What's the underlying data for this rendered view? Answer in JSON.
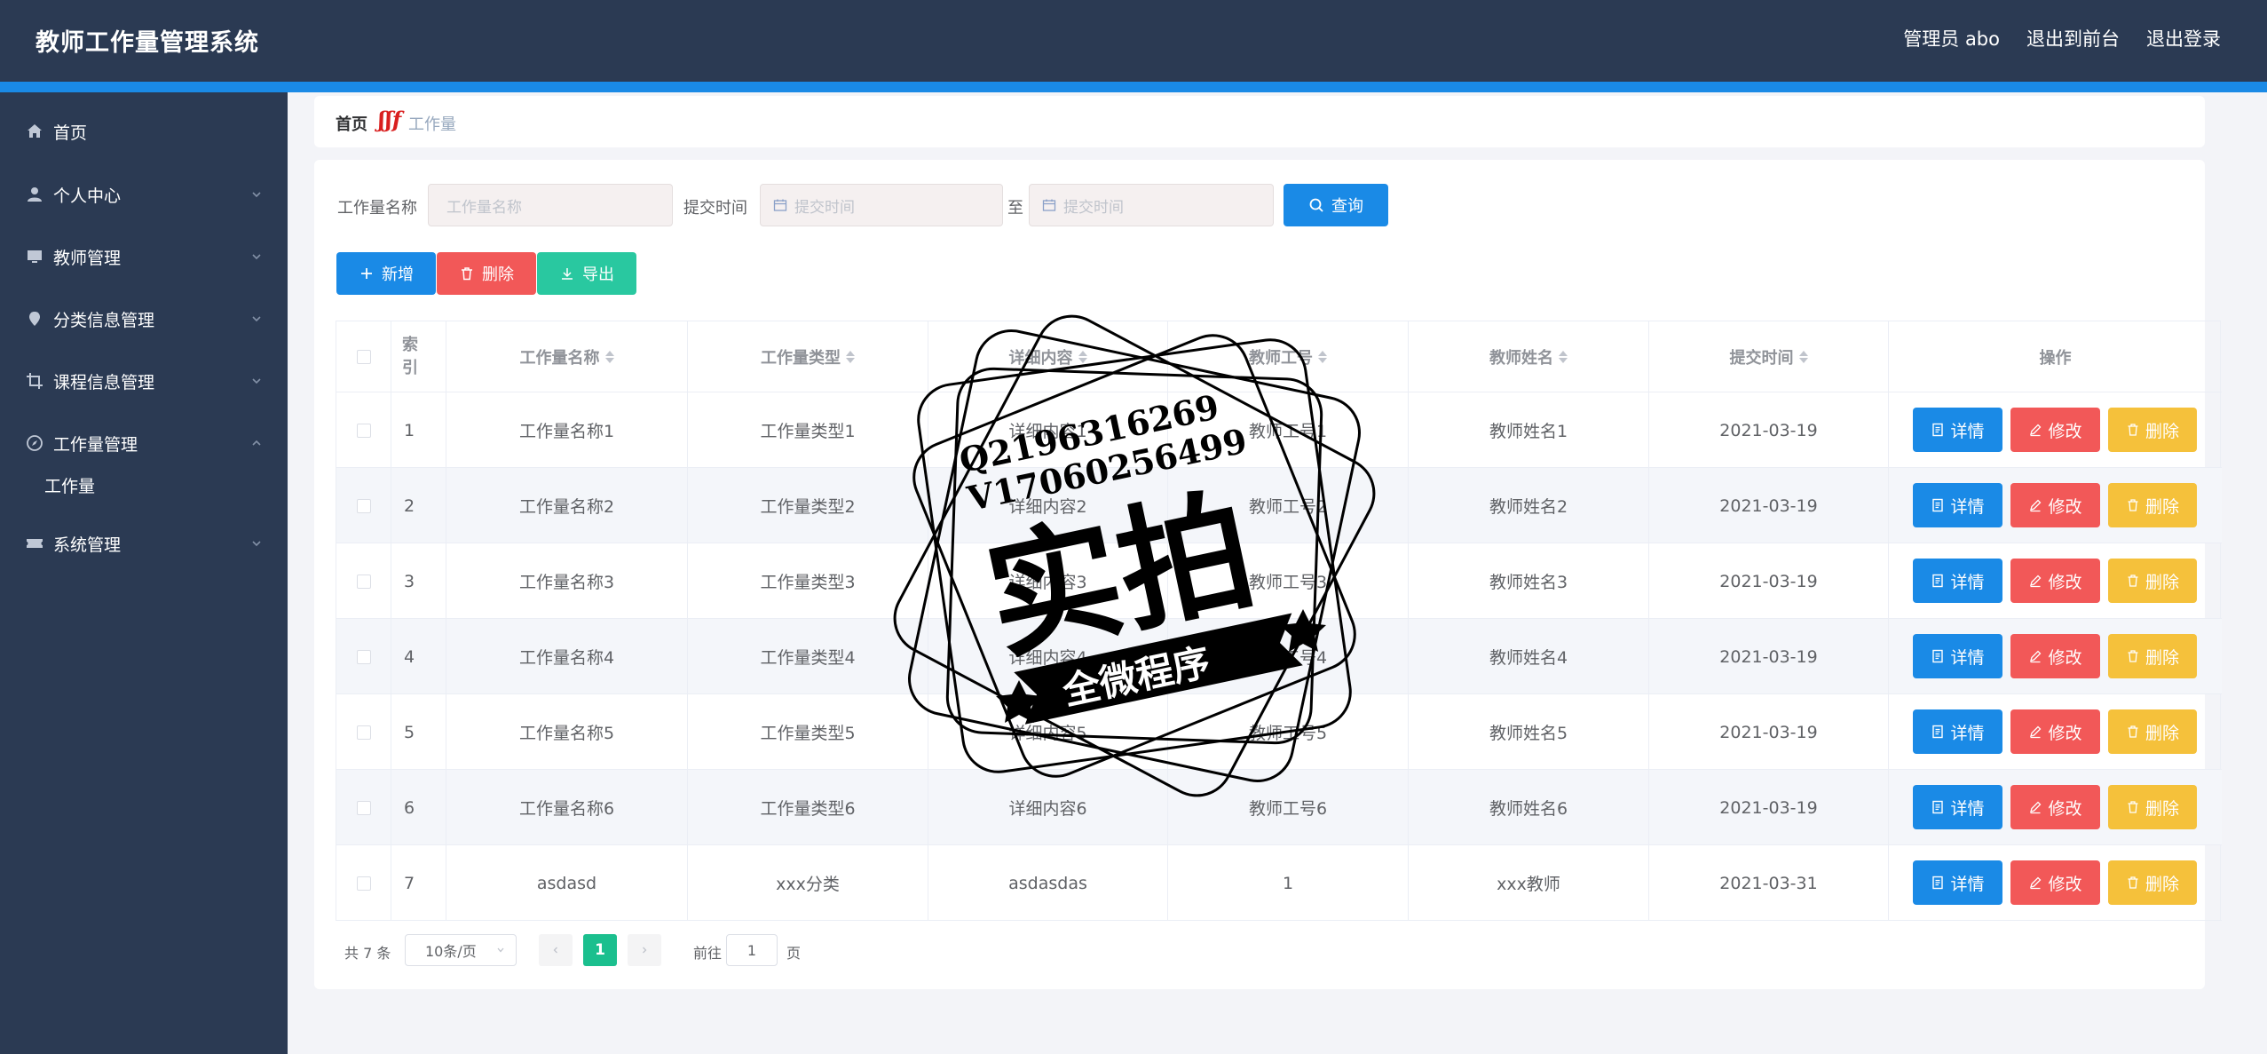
{
  "app": {
    "title": "教师工作量管理系统"
  },
  "header": {
    "user": "管理员 abo",
    "front": "退出到前台",
    "logout": "退出登录"
  },
  "sidebar": {
    "items": [
      {
        "label": "首页",
        "icon": "home-icon"
      },
      {
        "label": "个人中心",
        "icon": "user-icon"
      },
      {
        "label": "教师管理",
        "icon": "monitor-icon"
      },
      {
        "label": "分类信息管理",
        "icon": "location-icon"
      },
      {
        "label": "课程信息管理",
        "icon": "crop-icon"
      },
      {
        "label": "工作量管理",
        "icon": "compass-icon"
      },
      {
        "label": "系统管理",
        "icon": "ticket-icon"
      }
    ],
    "sub_item": "工作量"
  },
  "breadcrumb": {
    "home": "首页",
    "current": "工作量"
  },
  "filters": {
    "name_label": "工作量名称",
    "name_placeholder": "工作量名称",
    "time_label": "提交时间",
    "start_placeholder": "提交时间",
    "to": "至",
    "end_placeholder": "提交时间",
    "search": "查询"
  },
  "actions": {
    "add": "新增",
    "delete": "删除",
    "export": "导出"
  },
  "table": {
    "headers": [
      "索引",
      "工作量名称",
      "工作量类型",
      "详细内容",
      "教师工号",
      "教师姓名",
      "提交时间",
      "操作"
    ],
    "rows": [
      [
        "1",
        "工作量名称1",
        "工作量类型1",
        "详细内容1",
        "教师工号1",
        "教师姓名1",
        "2021-03-19"
      ],
      [
        "2",
        "工作量名称2",
        "工作量类型2",
        "详细内容2",
        "教师工号2",
        "教师姓名2",
        "2021-03-19"
      ],
      [
        "3",
        "工作量名称3",
        "工作量类型3",
        "详细内容3",
        "教师工号3",
        "教师姓名3",
        "2021-03-19"
      ],
      [
        "4",
        "工作量名称4",
        "工作量类型4",
        "详细内容4",
        "教师工号4",
        "教师姓名4",
        "2021-03-19"
      ],
      [
        "5",
        "工作量名称5",
        "工作量类型5",
        "详细内容5",
        "教师工号5",
        "教师姓名5",
        "2021-03-19"
      ],
      [
        "6",
        "工作量名称6",
        "工作量类型6",
        "详细内容6",
        "教师工号6",
        "教师姓名6",
        "2021-03-19"
      ],
      [
        "7",
        "asdasd",
        "xxx分类",
        "asdasdas",
        "1",
        "xxx教师",
        "2021-03-31"
      ]
    ],
    "row_actions": {
      "detail": "详情",
      "edit": "修改",
      "delete": "删除"
    }
  },
  "pagination": {
    "total": "共 7 条",
    "page_size": "10条/页",
    "current": "1",
    "goto": "前往",
    "page_input": "1",
    "page_unit": "页"
  },
  "watermark": {
    "line1": "Q2196316269",
    "line2": "V17060256499",
    "big": "实拍",
    "ribbon": "全微程序"
  },
  "colors": {
    "header_bg": "#2b3a53",
    "accent": "#1a8ae6",
    "primary": "#1a8ae6",
    "danger": "#f25858",
    "success": "#29c8a0",
    "warning": "#f5c13b",
    "pager_active": "#1bbf8e"
  }
}
